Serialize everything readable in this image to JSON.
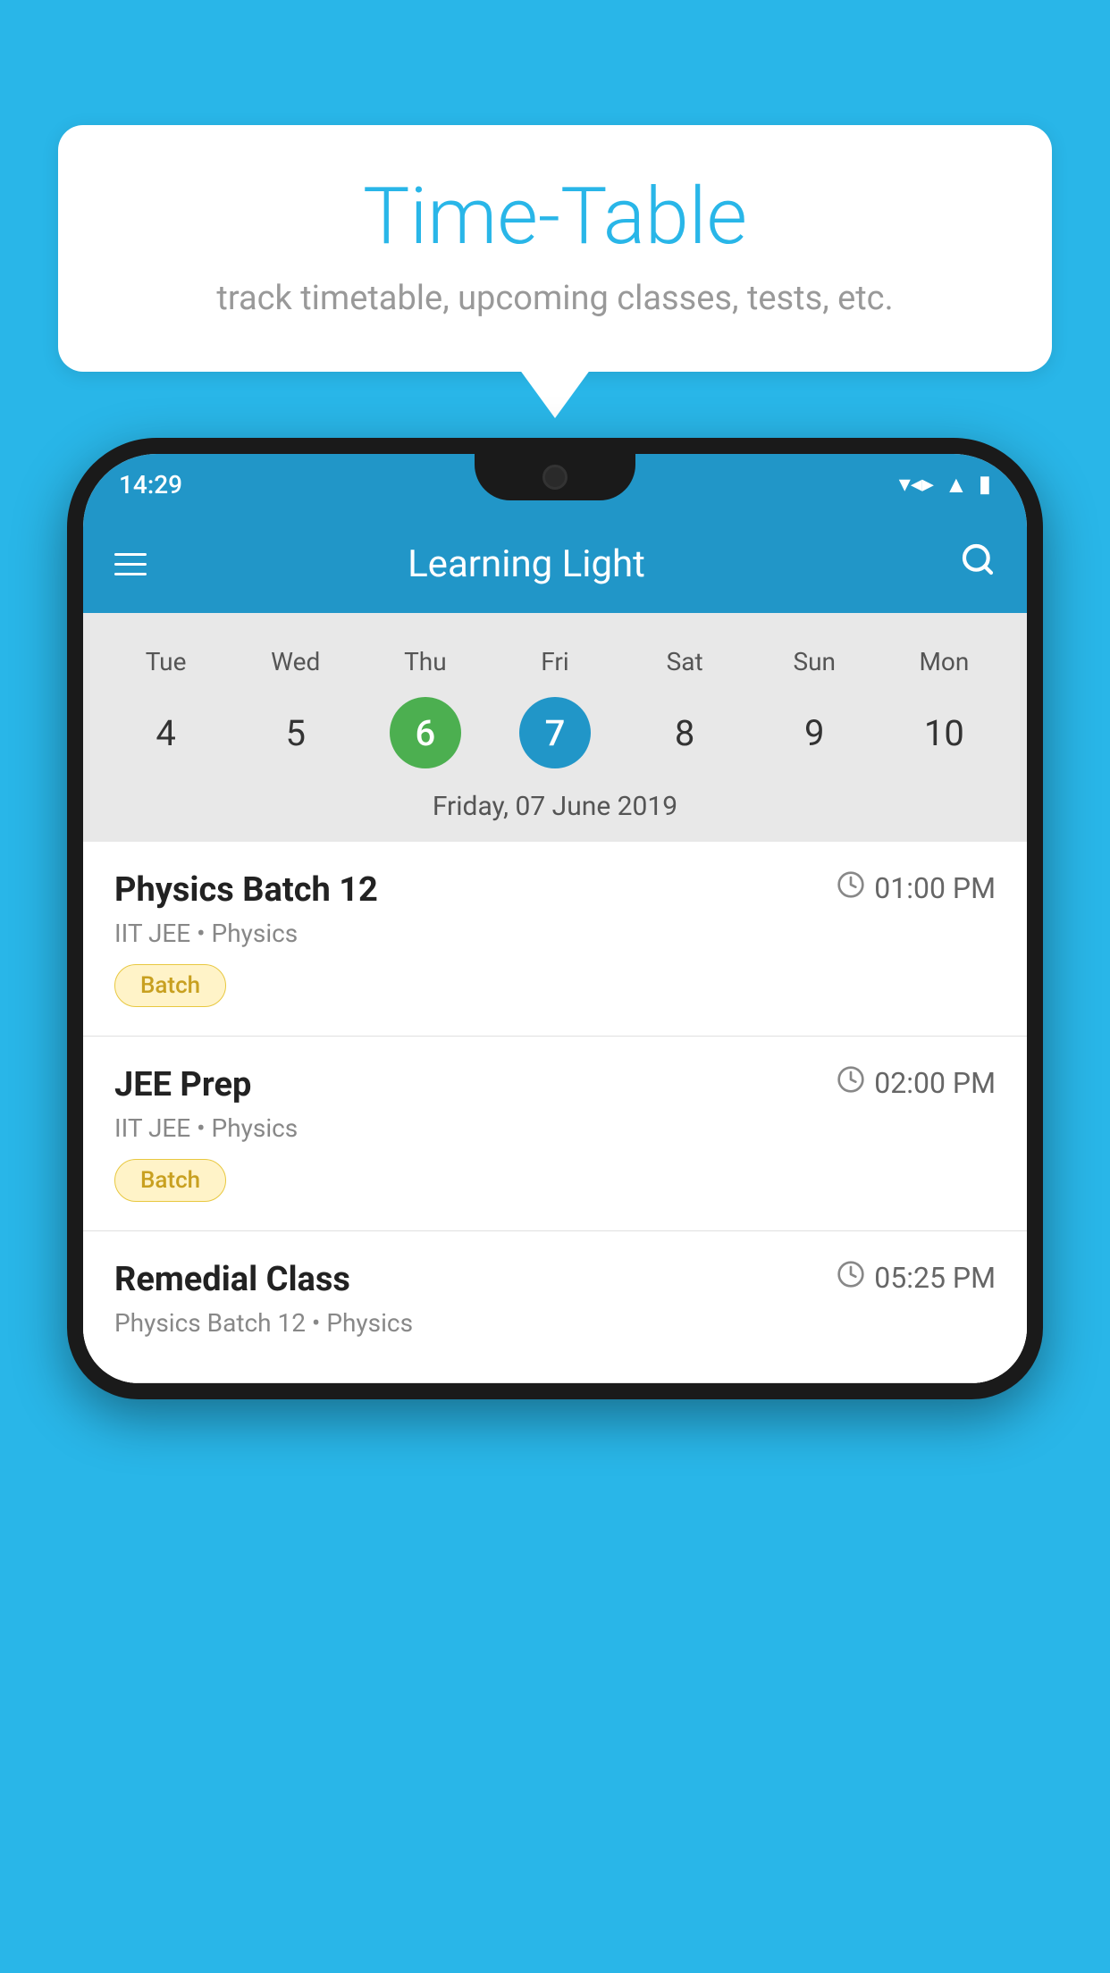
{
  "background_color": "#29B6E8",
  "bubble": {
    "title": "Time-Table",
    "subtitle": "track timetable, upcoming classes, tests, etc."
  },
  "phone": {
    "status_bar": {
      "time": "14:29"
    },
    "app_bar": {
      "title": "Learning Light"
    },
    "calendar": {
      "days_of_week": [
        "Tue",
        "Wed",
        "Thu",
        "Fri",
        "Sat",
        "Sun",
        "Mon"
      ],
      "dates": [
        "4",
        "5",
        "6",
        "7",
        "8",
        "9",
        "10"
      ],
      "today_index": 2,
      "selected_index": 3,
      "selected_date_label": "Friday, 07 June 2019"
    },
    "schedule": [
      {
        "title": "Physics Batch 12",
        "time": "01:00 PM",
        "subtitle": "IIT JEE • Physics",
        "badge": "Batch"
      },
      {
        "title": "JEE Prep",
        "time": "02:00 PM",
        "subtitle": "IIT JEE • Physics",
        "badge": "Batch"
      },
      {
        "title": "Remedial Class",
        "time": "05:25 PM",
        "subtitle": "Physics Batch 12 • Physics",
        "badge": null
      }
    ]
  }
}
